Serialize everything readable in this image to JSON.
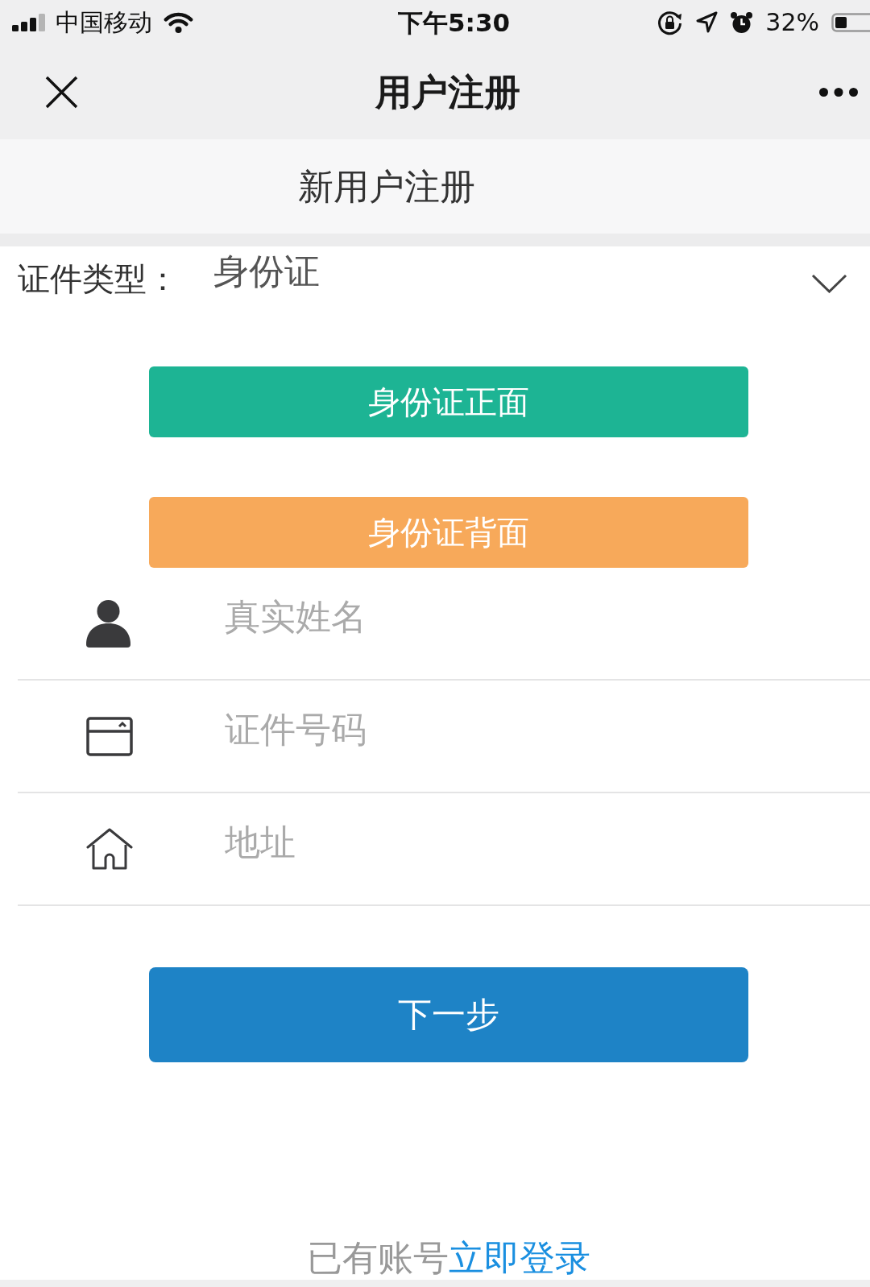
{
  "status_bar": {
    "carrier": "中国移动",
    "time": "下午5:30",
    "battery": "32%"
  },
  "nav_bar": {
    "title": "用户注册"
  },
  "header": {
    "title": "新用户注册"
  },
  "id_type": {
    "label": "证件类型：",
    "value": "身份证"
  },
  "upload_buttons": [
    {
      "label": "身份证正面",
      "color": "#1db494"
    },
    {
      "label": "身份证背面",
      "color": "#f7a95a"
    }
  ],
  "fields": [
    {
      "kind": "person",
      "placeholder": "真实姓名"
    },
    {
      "kind": "card",
      "placeholder": "证件号码"
    },
    {
      "kind": "home",
      "placeholder": "地址"
    }
  ],
  "next_button": {
    "label": "下一步"
  },
  "footer": {
    "text": "已有账号",
    "link": "立即登录"
  }
}
